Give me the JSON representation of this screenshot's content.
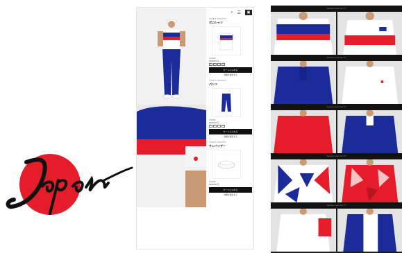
{
  "logo": {
    "text": "Japan"
  },
  "header": {
    "cart_icon": "cart-icon",
    "search_icon": "search-icon",
    "menu_icon": "menu-icon"
  },
  "items": [
    {
      "cat": "Sample Launcher",
      "name": "ポロシャツ",
      "meta1": "¥ 0,000",
      "meta2": "0000000 円",
      "cta": "カートにいれる",
      "sub": "詳細を確認する"
    },
    {
      "cat": "Sample Launcher",
      "name": "パンツ",
      "meta1": "¥ 0,000",
      "meta2": "0000000 円",
      "cta": "カートにいれる",
      "sub": "詳細を確認する"
    },
    {
      "cat": "Sample Launcher",
      "name": "サンバイザー",
      "meta1": "¥ 0,000",
      "meta2": "0000000 円",
      "cta": "カートにいれる",
      "sub": "詳細を確認する"
    }
  ],
  "gallery": {
    "bars": [
      "Sample Launcher TT",
      "Sample Launcher TT",
      "Sample Launcher TT",
      "Sample Launcher TT",
      "Sample Launcher TT"
    ]
  },
  "colors": {
    "red": "#e51d2a",
    "blue": "#1c2b9a",
    "white": "#ffffff",
    "dark": "#111111"
  }
}
